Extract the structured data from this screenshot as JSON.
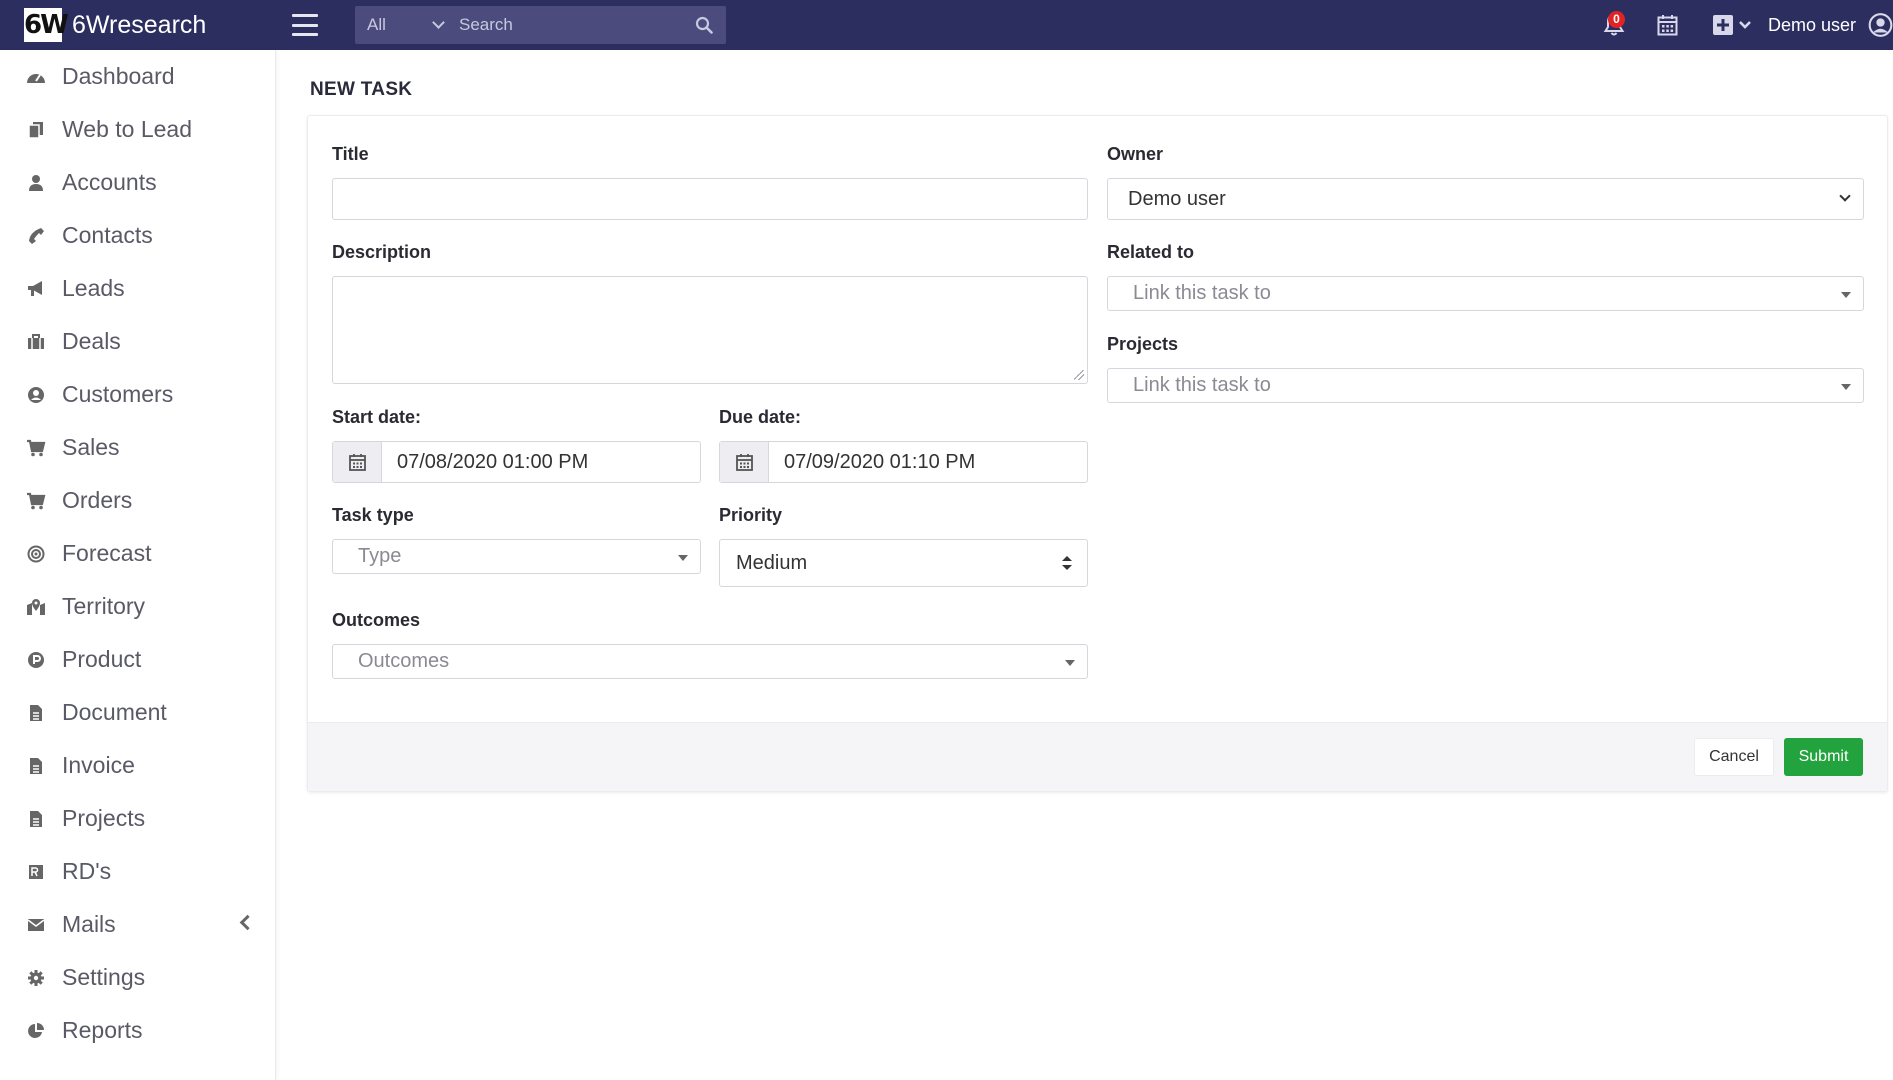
{
  "app": {
    "logo_text": "6W",
    "name": "6Wresearch"
  },
  "search": {
    "scope": "All",
    "placeholder": "Search"
  },
  "topbar": {
    "notification_count": "0",
    "user_name": "Demo user"
  },
  "sidebar": {
    "items": [
      {
        "label": "Dashboard",
        "icon": "dashboard-icon"
      },
      {
        "label": "Web to Lead",
        "icon": "copy-icon"
      },
      {
        "label": "Accounts",
        "icon": "user-icon"
      },
      {
        "label": "Contacts",
        "icon": "phone-icon"
      },
      {
        "label": "Leads",
        "icon": "bullhorn-icon"
      },
      {
        "label": "Deals",
        "icon": "briefcase-icon"
      },
      {
        "label": "Customers",
        "icon": "user-circle-icon"
      },
      {
        "label": "Sales",
        "icon": "cart-icon"
      },
      {
        "label": "Orders",
        "icon": "cart-icon"
      },
      {
        "label": "Forecast",
        "icon": "bullseye-icon"
      },
      {
        "label": "Territory",
        "icon": "map-marker-icon"
      },
      {
        "label": "Product",
        "icon": "product-icon"
      },
      {
        "label": "Document",
        "icon": "file-icon"
      },
      {
        "label": "Invoice",
        "icon": "file-icon"
      },
      {
        "label": "Projects",
        "icon": "file-icon"
      },
      {
        "label": "RD's",
        "icon": "rd-icon"
      },
      {
        "label": "Mails",
        "icon": "envelope-icon"
      },
      {
        "label": "Settings",
        "icon": "gear-icon"
      },
      {
        "label": "Reports",
        "icon": "pie-chart-icon"
      }
    ]
  },
  "page": {
    "title": "NEW TASK"
  },
  "form": {
    "title_label": "Title",
    "title_value": "",
    "description_label": "Description",
    "description_value": "",
    "start_label": "Start date:",
    "start_value": "07/08/2020 01:00 PM",
    "due_label": "Due date:",
    "due_value": "07/09/2020 01:10 PM",
    "type_label": "Task type",
    "type_placeholder": "Type",
    "priority_label": "Priority",
    "priority_value": "Medium",
    "outcomes_label": "Outcomes",
    "outcomes_placeholder": "Outcomes",
    "owner_label": "Owner",
    "owner_value": "Demo user",
    "related_label": "Related to",
    "related_placeholder": "Link this task to",
    "projects_label": "Projects",
    "projects_placeholder": "Link this task to"
  },
  "actions": {
    "cancel": "Cancel",
    "submit": "Submit"
  },
  "colors": {
    "topbar": "#2d2e60",
    "submit": "#22a33d",
    "badge": "#e02424"
  }
}
